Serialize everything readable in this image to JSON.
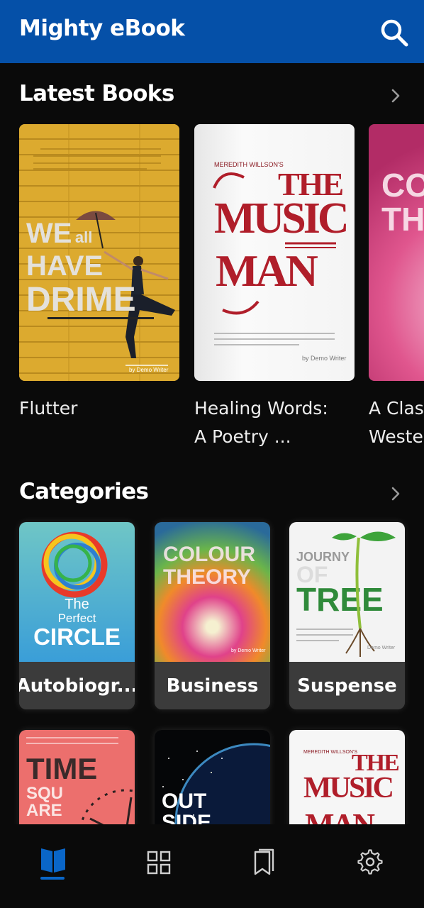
{
  "app": {
    "title": "Mighty eBook"
  },
  "sections": {
    "latest": {
      "title": "Latest Books"
    },
    "categories": {
      "title": "Categories"
    }
  },
  "latest_books": [
    {
      "title": "Flutter",
      "cover": {
        "lines": [
          "WE",
          "all",
          "HAVE",
          "DRIME"
        ],
        "author": "by Demo Writer"
      }
    },
    {
      "title": "Healing Words:\nA Poetry ...",
      "cover": {
        "author_top": "MEREDITH WILLSON'S",
        "lines": [
          "THE",
          "MUSIC",
          "MAN"
        ],
        "author": "by Demo Writer"
      }
    },
    {
      "title": "A Clas\nWeste",
      "cover": {
        "lines": [
          "CO",
          "TH"
        ]
      }
    }
  ],
  "categories": [
    {
      "label": "Autobiogr...",
      "cover": {
        "lines": [
          "The",
          "Perfect",
          "CIRCLE"
        ]
      }
    },
    {
      "label": "Business",
      "cover": {
        "lines": [
          "COLOUR",
          "THEORY"
        ],
        "author": "by Demo Writer"
      }
    },
    {
      "label": "Suspense",
      "cover": {
        "lines": [
          "JOURNY",
          "OF",
          "TREE"
        ],
        "author": "Demo Writer"
      }
    },
    {
      "label": "",
      "cover": {
        "lines": [
          "TIME",
          "SQU",
          "ARE"
        ]
      }
    },
    {
      "label": "",
      "cover": {
        "lines": [
          "OUT",
          "SIDE"
        ]
      }
    },
    {
      "label": "",
      "cover": {
        "author_top": "MEREDITH WILLSON'S",
        "lines": [
          "THE",
          "MUSIC",
          "MAN"
        ]
      }
    }
  ],
  "bottom_nav": {
    "items": [
      {
        "icon": "book-open-icon",
        "active": true
      },
      {
        "icon": "grid-icon",
        "active": false
      },
      {
        "icon": "bookmarks-icon",
        "active": false
      },
      {
        "icon": "gear-icon",
        "active": false
      }
    ],
    "active_color": "#0a66c8",
    "inactive_color": "#cccccc"
  },
  "colors": {
    "appbar": "#0550a8",
    "background": "#0a0a0a",
    "card_label_bg": "#3b3b3b"
  }
}
